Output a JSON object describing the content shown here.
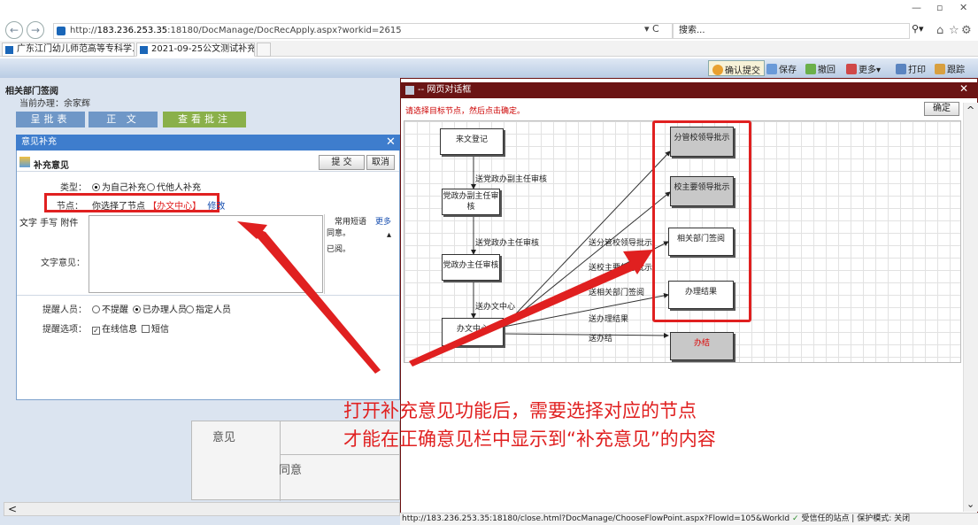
{
  "browser": {
    "url_prefix": "http://",
    "url_domain": "183.236.253.35",
    "url_rest": ":18180/DocManage/DocRecApply.aspx?workid=2615",
    "search_placeholder": "搜索...",
    "tabs": [
      {
        "label": "广东江门幼儿师范高等专科学..."
      },
      {
        "label": "2021-09-25公文测试补充..."
      }
    ],
    "back": "←",
    "forward": "→",
    "refresh": "▾ C",
    "search_icon": "⚲▾",
    "minimize": "—",
    "maximize": "▫",
    "close": "✕",
    "tab_close": "×"
  },
  "app_toolbar": {
    "confirm_label": "确认提交",
    "save_label": "保存",
    "return_label": "撤回",
    "more_label": "更多▾",
    "print_label": "打印",
    "track_label": "跟踪"
  },
  "left_page": {
    "section_title": "相关部门签阅",
    "current_user": "当前办理：余家辉",
    "tabs": [
      "呈批表",
      "正 文",
      "查看批注"
    ],
    "opinion_label": "意见",
    "agree_label": "同意",
    "scroll_left": "<"
  },
  "supplement_dialog": {
    "title": "意见补充",
    "heading": "补充意见",
    "submit_label": "提 交",
    "cancel_label": "取消",
    "type_label": "类型：",
    "type_options": [
      "为自己补充",
      "代他人补充"
    ],
    "node_label": "节点：",
    "node_prefix": "你选择了节点",
    "node_value": "【办文中心】",
    "node_edit": "修改",
    "text_opinion_label": "文字意见：",
    "side_tabs": "文字 手写 附件",
    "common_phrases": "常用短语",
    "more": "更多",
    "phrases": [
      "同意。",
      "已阅。"
    ],
    "remind_label": "提醒人员：",
    "remind_options": [
      "不提醒",
      "已办理人员",
      "指定人员"
    ],
    "remind_option_label": "提醒选项：",
    "remind_checks": [
      "在线信息",
      "短信"
    ],
    "close": "✕"
  },
  "modal": {
    "title": "-- 网页对话框",
    "hint": "请选择目标节点，然后点击确定。",
    "ok_label": "确定",
    "status_url": "http://183.236.253.35:18180/close.html?DocManage/ChooseFlowPoint.aspx?FlowId=105&WorkId",
    "status_trusted": "受信任的站点 | 保护模式: 关闭",
    "scroll_up": "^",
    "scroll_down": "⌄"
  },
  "flow": {
    "nodes": {
      "start": "来文登记",
      "n1": "党政办副主任审核",
      "n2": "党政办主任审核",
      "n3": "办文中心",
      "t1": "分管校领导批示",
      "t2": "校主要领导批示",
      "t3": "相关部门签阅",
      "t4": "办理结果",
      "end": "办结"
    },
    "edges": {
      "e1": "送党政办副主任审核",
      "e2": "送党政办主任审核",
      "e3": "送办文中心",
      "e4": "送分管校领导批示",
      "e5": "送校主要领导批示",
      "e6": "送相关部门签阅",
      "e7": "送办理结果",
      "e8": "送办结"
    }
  },
  "annotation": {
    "line1": "打开补充意见功能后，需要选择对应的节点",
    "line2": "才能在正确意见栏中显示到“补充意见”的内容"
  },
  "colors": {
    "highlight": "#e02020",
    "modal_header": "#6b1414",
    "dialog_header": "#3e7dcd"
  }
}
